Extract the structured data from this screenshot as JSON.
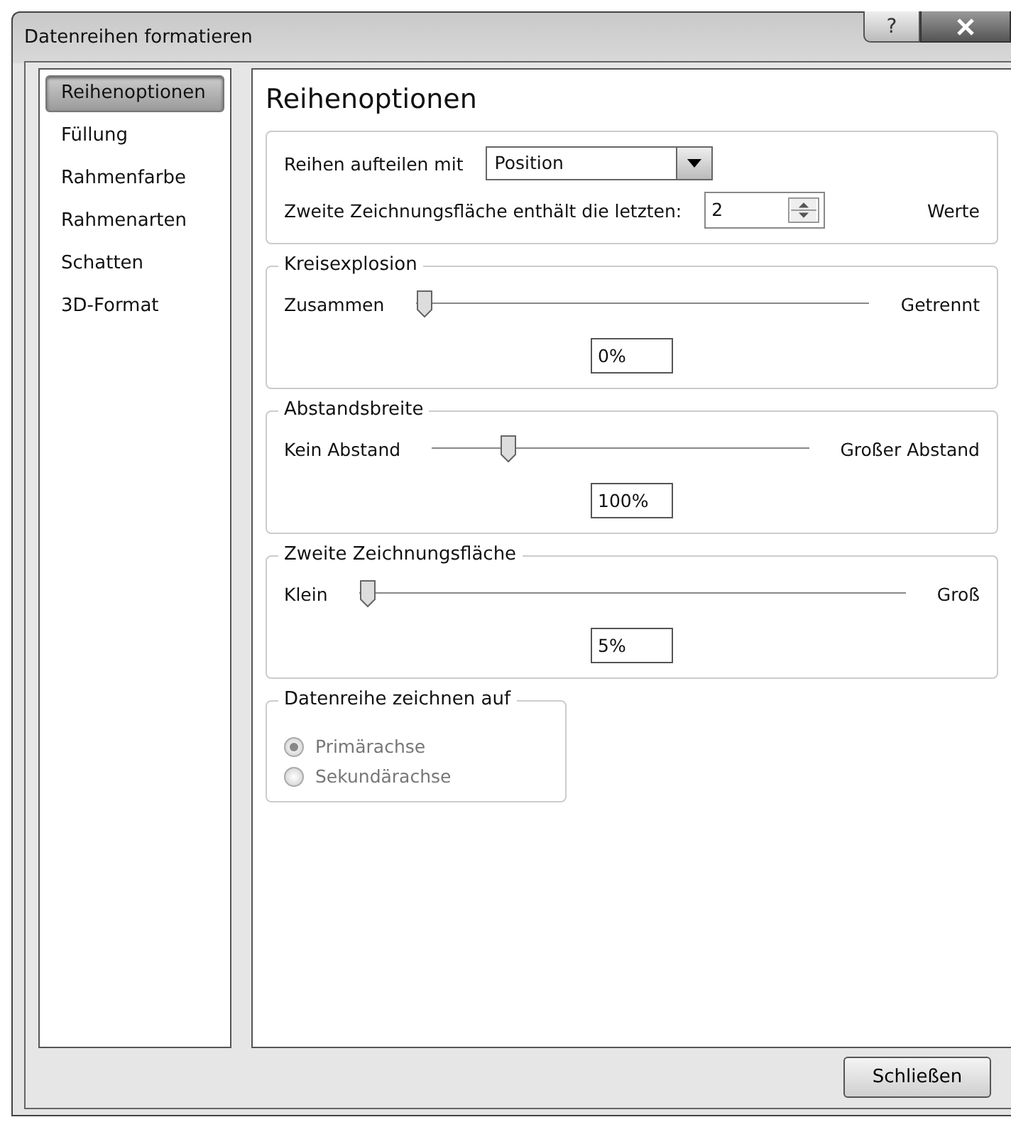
{
  "window": {
    "title": "Datenreihen formatieren",
    "help_label": "?"
  },
  "sidebar": {
    "items": [
      {
        "label": "Reihenoptionen",
        "selected": true
      },
      {
        "label": "Füllung",
        "selected": false
      },
      {
        "label": "Rahmenfarbe",
        "selected": false
      },
      {
        "label": "Rahmenarten",
        "selected": false
      },
      {
        "label": "Schatten",
        "selected": false
      },
      {
        "label": "3D-Format",
        "selected": false
      }
    ]
  },
  "panel": {
    "title": "Reihenoptionen",
    "split": {
      "label": "Reihen aufteilen mit",
      "value": "Position"
    },
    "last_values": {
      "label": "Zweite Zeichnungsfläche enthält die letzten:",
      "value": "2",
      "unit": "Werte"
    },
    "sliders": [
      {
        "title": "Kreisexplosion",
        "min_label": "Zusammen",
        "max_label": "Getrennt",
        "level": 0,
        "value": "0%"
      },
      {
        "title": "Abstandsbreite",
        "min_label": "Kein Abstand",
        "max_label": "Großer Abstand",
        "level": 0.19,
        "value": "100%"
      },
      {
        "title": "Zweite Zeichnungsfläche",
        "min_label": "Klein",
        "max_label": "Groß",
        "level": 0,
        "value": "5%"
      }
    ],
    "plot_on": {
      "title": "Datenreihe zeichnen auf",
      "disabled": true,
      "options": [
        {
          "label": "Primärachse",
          "selected": true
        },
        {
          "label": "Sekundärachse",
          "selected": false
        }
      ]
    }
  },
  "buttons": [
    {
      "label": "Schließen"
    }
  ]
}
